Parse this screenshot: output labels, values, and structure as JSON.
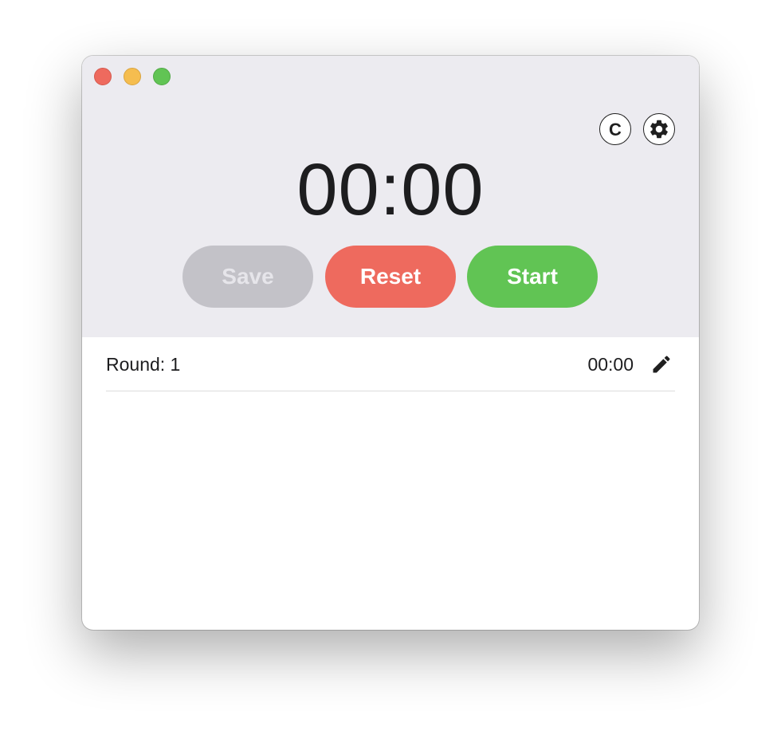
{
  "window": {
    "controls": [
      "close",
      "minimize",
      "maximize"
    ]
  },
  "header": {
    "copyright_button_label": "C",
    "settings_icon": "gear-icon",
    "timer_display": "00:00"
  },
  "actions": {
    "save_label": "Save",
    "reset_label": "Reset",
    "start_label": "Start"
  },
  "rounds": [
    {
      "label": "Round: 1",
      "time": "00:00",
      "edit_icon": "pencil-icon"
    }
  ],
  "colors": {
    "close": "#ee6a5e",
    "minimize": "#f5bd4f",
    "maximize": "#61c454",
    "save_disabled": "#c3c2c8",
    "reset": "#ee6a5e",
    "start": "#61c454",
    "top_background": "#ecebf0"
  }
}
